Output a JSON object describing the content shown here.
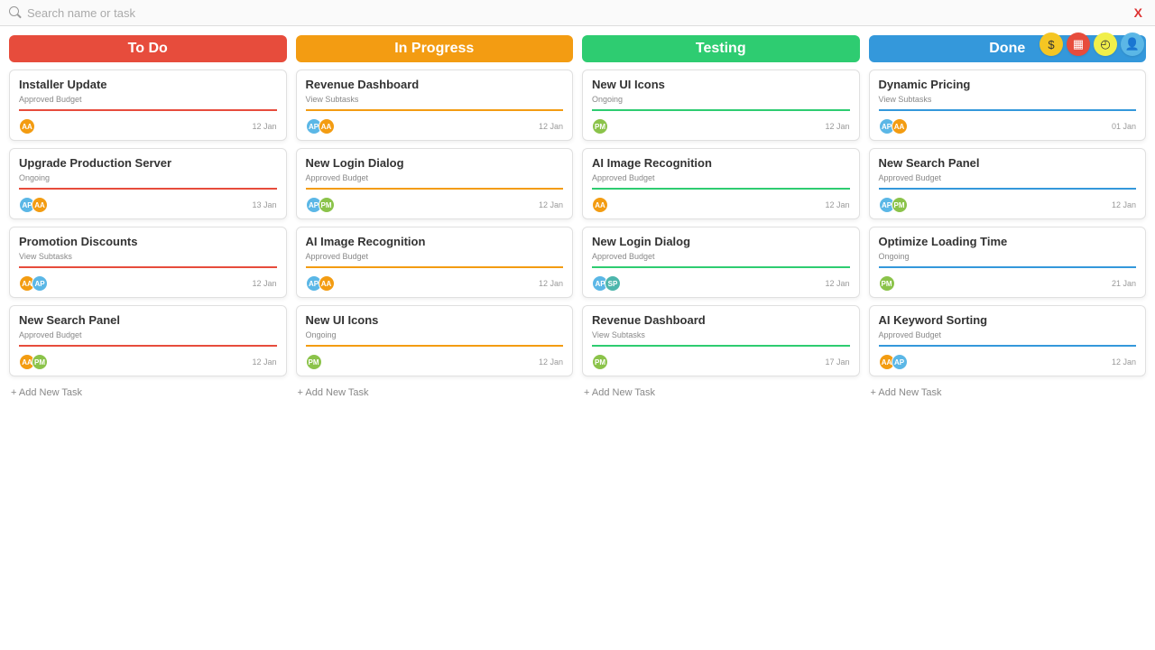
{
  "search": {
    "placeholder": "Search name or task",
    "clear_label": "X"
  },
  "header_icons": {
    "money": {
      "bg": "#f5c623",
      "glyph": "$"
    },
    "calendar": {
      "bg": "#e74c3c",
      "glyph": "▦",
      "fg": "#fff"
    },
    "clock": {
      "bg": "#f1ef4a",
      "glyph": "◴"
    },
    "avatar": {
      "bg": "#5bb7e6",
      "glyph": "👤",
      "fg": "#fff"
    }
  },
  "add_task_label": "+ Add New Task",
  "avatar_colors": {
    "AP": "#5bb7e6",
    "AA": "#f39c12",
    "PM": "#8bc34a",
    "SP": "#4db6ac"
  },
  "column_colors": {
    "todo": "#e74c3c",
    "in_progress": "#f39c12",
    "testing": "#2ecc71",
    "done": "#3498db"
  },
  "columns": [
    {
      "id": "todo",
      "title": "To Do",
      "cards": [
        {
          "title": "Installer Update",
          "subtitle": "Approved Budget",
          "avatars": [
            "AA"
          ],
          "date": "12 Jan",
          "accent": "#e74c3c"
        },
        {
          "title": "Upgrade Production Server",
          "subtitle": "Ongoing",
          "avatars": [
            "AP",
            "AA"
          ],
          "date": "13 Jan",
          "accent": "#e74c3c"
        },
        {
          "title": "Promotion Discounts",
          "subtitle": "View Subtasks",
          "avatars": [
            "AA",
            "AP"
          ],
          "date": "12 Jan",
          "accent": "#e74c3c"
        },
        {
          "title": "New Search Panel",
          "subtitle": "Approved Budget",
          "avatars": [
            "AA",
            "PM"
          ],
          "date": "12 Jan",
          "accent": "#e74c3c"
        }
      ]
    },
    {
      "id": "in_progress",
      "title": "In Progress",
      "cards": [
        {
          "title": "Revenue Dashboard",
          "subtitle": "View Subtasks",
          "avatars": [
            "AP",
            "AA"
          ],
          "date": "12 Jan",
          "accent": "#f39c12"
        },
        {
          "title": "New Login Dialog",
          "subtitle": "Approved Budget",
          "avatars": [
            "AP",
            "PM"
          ],
          "date": "12 Jan",
          "accent": "#f39c12"
        },
        {
          "title": "AI Image Recognition",
          "subtitle": "Approved Budget",
          "avatars": [
            "AP",
            "AA"
          ],
          "date": "12 Jan",
          "accent": "#f39c12"
        },
        {
          "title": "New UI Icons",
          "subtitle": "Ongoing",
          "avatars": [
            "PM"
          ],
          "date": "12 Jan",
          "accent": "#f39c12"
        }
      ]
    },
    {
      "id": "testing",
      "title": "Testing",
      "cards": [
        {
          "title": "New UI Icons",
          "subtitle": "Ongoing",
          "avatars": [
            "PM"
          ],
          "date": "12 Jan",
          "accent": "#2ecc71"
        },
        {
          "title": "AI Image Recognition",
          "subtitle": "Approved Budget",
          "avatars": [
            "AA"
          ],
          "date": "12 Jan",
          "accent": "#2ecc71"
        },
        {
          "title": "New Login Dialog",
          "subtitle": "Approved Budget",
          "avatars": [
            "AP",
            "SP"
          ],
          "date": "12 Jan",
          "accent": "#2ecc71"
        },
        {
          "title": "Revenue Dashboard",
          "subtitle": "View Subtasks",
          "avatars": [
            "PM"
          ],
          "date": "17 Jan",
          "accent": "#2ecc71"
        }
      ]
    },
    {
      "id": "done",
      "title": "Done",
      "cards": [
        {
          "title": "Dynamic Pricing",
          "subtitle": "View Subtasks",
          "avatars": [
            "AP",
            "AA"
          ],
          "date": "01 Jan",
          "accent": "#3498db"
        },
        {
          "title": "New Search Panel",
          "subtitle": "Approved Budget",
          "avatars": [
            "AP",
            "PM"
          ],
          "date": "12 Jan",
          "accent": "#3498db"
        },
        {
          "title": "Optimize Loading Time",
          "subtitle": "Ongoing",
          "avatars": [
            "PM"
          ],
          "date": "21 Jan",
          "accent": "#3498db"
        },
        {
          "title": "AI Keyword Sorting",
          "subtitle": "Approved Budget",
          "avatars": [
            "AA",
            "AP"
          ],
          "date": "12 Jan",
          "accent": "#3498db"
        }
      ]
    }
  ]
}
